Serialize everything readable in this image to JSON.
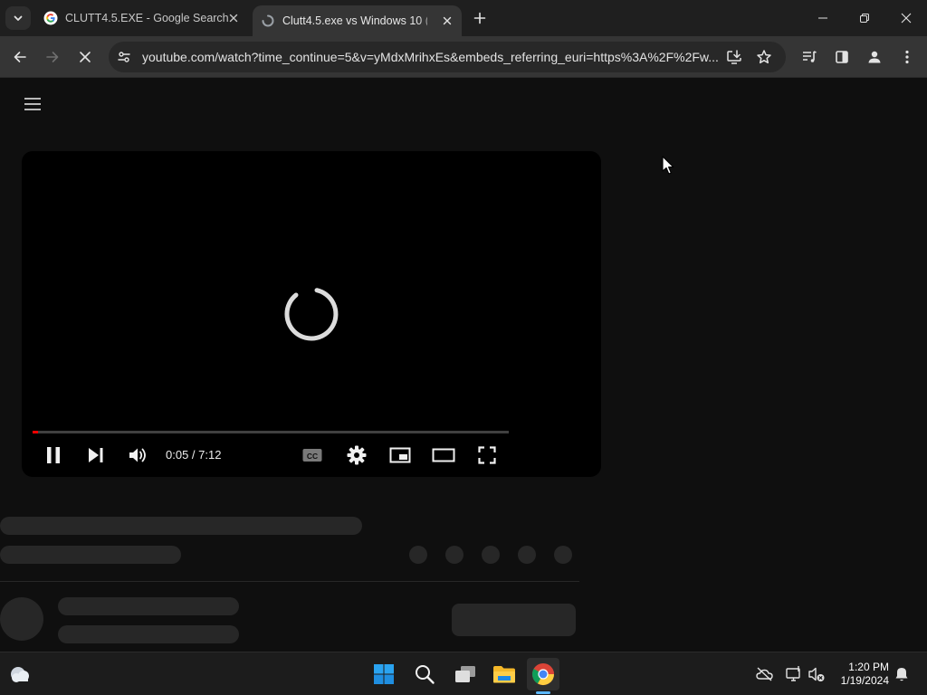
{
  "browser": {
    "tabs": [
      {
        "title": "CLUTT4.5.EXE - Google Search",
        "active": false,
        "favicon": "google-g-icon"
      },
      {
        "title": "Clutt4.5.exe vs Windows 10 (Do",
        "active": true,
        "favicon": "loading-spinner-icon"
      }
    ],
    "url": "youtube.com/watch?time_continue=5&v=yMdxMrihxEs&embeds_referring_euri=https%3A%2F%2Fw...",
    "window_controls": [
      "minimize",
      "restore",
      "close"
    ]
  },
  "player": {
    "time_display": "0:05 / 7:12",
    "current_time": "0:05",
    "duration": "7:12",
    "progress_fraction": 0.012,
    "state": "buffering",
    "controls": [
      "pause",
      "next",
      "volume",
      "captions",
      "settings",
      "miniplayer",
      "theater",
      "fullscreen"
    ]
  },
  "taskbar": {
    "time": "1:20 PM",
    "date": "1/19/2024",
    "pinned": [
      "start-icon",
      "search-icon",
      "task-view-icon",
      "file-explorer-icon",
      "chrome-icon"
    ]
  },
  "colors": {
    "progress": "#ff0000",
    "page_bg": "#0f0f0f",
    "skeleton": "#272727",
    "win_blue": "#0a84ff"
  }
}
